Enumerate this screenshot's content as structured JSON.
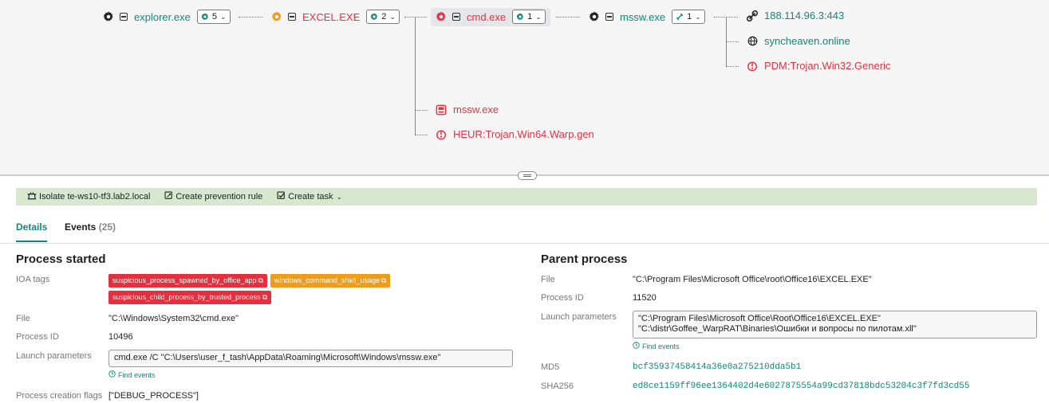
{
  "graph": {
    "processes": [
      {
        "name": "explorer.exe",
        "count": "5"
      },
      {
        "name": "EXCEL.EXE",
        "count": "2"
      },
      {
        "name": "cmd.exe",
        "count": "1"
      },
      {
        "name": "mssw.exe",
        "count": "1"
      }
    ],
    "network": [
      "188.114.96.3:443",
      "syncheaven.online"
    ],
    "detection_top": "PDM:Trojan.Win32.Generic",
    "cmd_children": {
      "file": "mssw.exe",
      "detection": "HEUR:Trojan.Win64.Warp.gen"
    }
  },
  "actions": {
    "isolate": "Isolate te-ws10-tf3.lab2.local",
    "prevention": "Create prevention rule",
    "task": "Create task"
  },
  "tabs": {
    "details": "Details",
    "events": "Events",
    "events_count": "(25)"
  },
  "process": {
    "title": "Process started",
    "ioa_label": "IOA tags",
    "tags": [
      "suspicious_process_spawned_by_office_app",
      "windows_command_shell_usage",
      "suspicious_child_process_by_trusted_process"
    ],
    "file_label": "File",
    "file": "\"C:\\Windows\\System32\\cmd.exe\"",
    "pid_label": "Process ID",
    "pid": "10496",
    "launch_label": "Launch parameters",
    "launch": "cmd.exe /C \"C:\\Users\\user_f_tash\\AppData\\Roaming\\Microsoft\\Windows\\mssw.exe\"",
    "find_events": "Find events",
    "flags_label": "Process creation flags",
    "flags": "[\"DEBUG_PROCESS\"]"
  },
  "parent": {
    "title": "Parent process",
    "file_label": "File",
    "file": "\"C:\\Program Files\\Microsoft Office\\root\\Office16\\EXCEL.EXE\"",
    "pid_label": "Process ID",
    "pid": "11520",
    "launch_label": "Launch parameters",
    "launch": "\"C:\\Program Files\\Microsoft Office\\Root\\Office16\\EXCEL.EXE\" \"C:\\distr\\Goffee_WarpRAT\\Binaries\\Ошибки и вопросы по пилотам.xll\"",
    "find_events": "Find events",
    "md5_label": "MD5",
    "md5": "bcf35937458414a36e0a275210dda5b1",
    "sha_label": "SHA256",
    "sha": "ed8ce1159ff96ee1364402d4e6027875554a99cd37818bdc53204c3f7fd3cd55"
  },
  "colors": {
    "accent": "#10877b",
    "danger": "#e53344",
    "warning": "#ee9c1c",
    "action_bar": "#d8e8cf"
  },
  "icons": [
    "gear-icon",
    "collapse-icon",
    "chevron-down-icon",
    "link-icon",
    "globe-icon",
    "detection-icon",
    "file-icon",
    "isolate-icon",
    "prevention-icon",
    "task-icon",
    "external-link-icon",
    "clock-icon"
  ]
}
